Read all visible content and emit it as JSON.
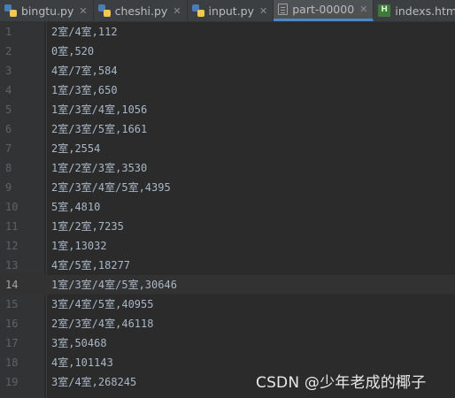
{
  "tabs": [
    {
      "label": "bingtu.py",
      "icon": "python-file-icon",
      "active": false
    },
    {
      "label": "cheshi.py",
      "icon": "python-file-icon",
      "active": false
    },
    {
      "label": "input.py",
      "icon": "python-file-icon",
      "active": false
    },
    {
      "label": "part-00000",
      "icon": "text-file-icon",
      "active": true
    },
    {
      "label": "indexs.html",
      "icon": "html-file-icon",
      "active": false
    }
  ],
  "editor": {
    "current_line": 14,
    "lines": [
      {
        "number": "1",
        "text": "2室/4室,112"
      },
      {
        "number": "2",
        "text": "0室,520"
      },
      {
        "number": "3",
        "text": "4室/7室,584"
      },
      {
        "number": "4",
        "text": "1室/3室,650"
      },
      {
        "number": "5",
        "text": "1室/3室/4室,1056"
      },
      {
        "number": "6",
        "text": "2室/3室/5室,1661"
      },
      {
        "number": "7",
        "text": "2室,2554"
      },
      {
        "number": "8",
        "text": "1室/2室/3室,3530"
      },
      {
        "number": "9",
        "text": "2室/3室/4室/5室,4395"
      },
      {
        "number": "10",
        "text": "5室,4810"
      },
      {
        "number": "11",
        "text": "1室/2室,7235"
      },
      {
        "number": "12",
        "text": "1室,13032"
      },
      {
        "number": "13",
        "text": "4室/5室,18277"
      },
      {
        "number": "14",
        "text": "1室/3室/4室/5室,30646"
      },
      {
        "number": "15",
        "text": "3室/4室/5室,40955"
      },
      {
        "number": "16",
        "text": "2室/3室/4室,46118"
      },
      {
        "number": "17",
        "text": "3室,50468"
      },
      {
        "number": "18",
        "text": "4室,101143"
      },
      {
        "number": "19",
        "text": "3室/4室,268245"
      }
    ]
  },
  "watermark": "CSDN @少年老成的椰子",
  "colors": {
    "background": "#2b2b2b",
    "gutter": "#313335",
    "text": "#a9b7c6",
    "line_number": "#606366",
    "active_tab_underline": "#4a88c7"
  }
}
